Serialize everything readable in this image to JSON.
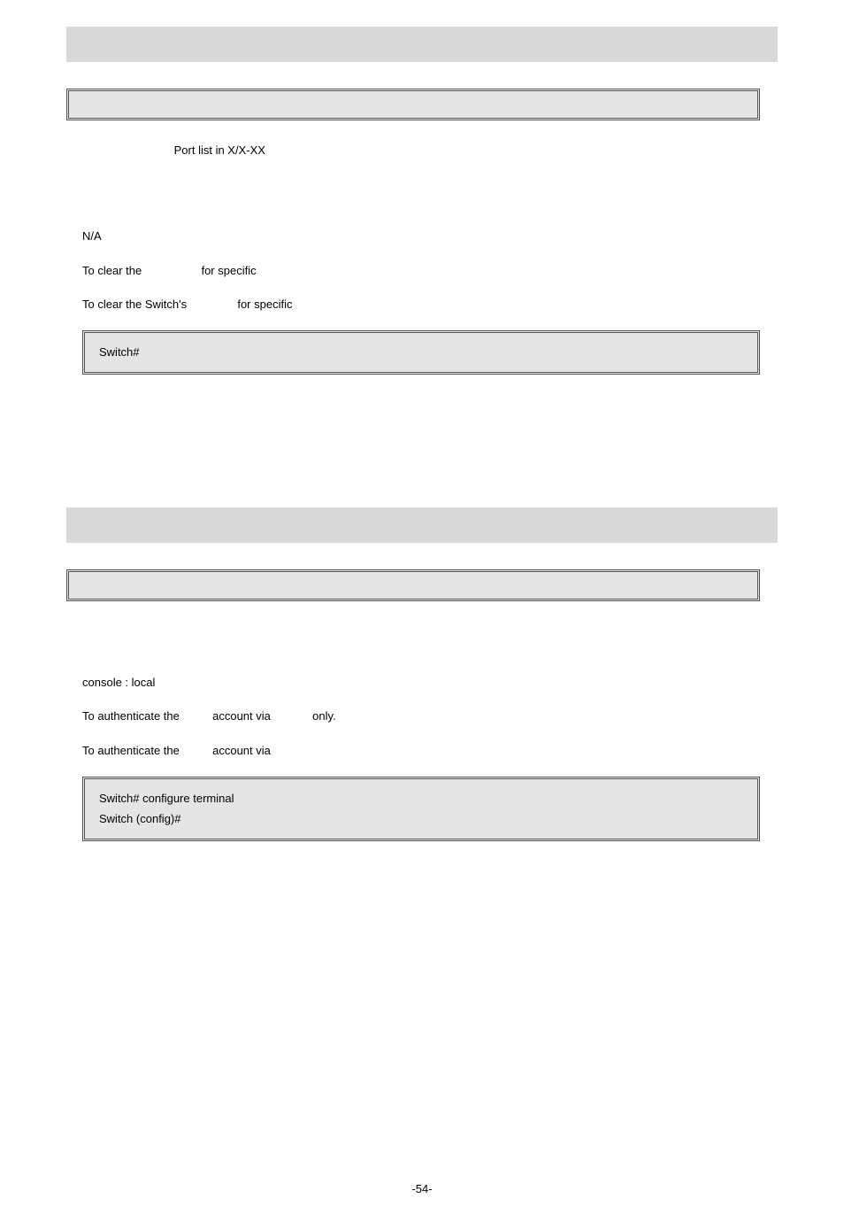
{
  "sec1": {
    "param_desc": "Port list in X/X-XX",
    "default_val": "N/A",
    "usage_line": {
      "pre": "To clear the",
      "post": "for specific"
    },
    "example_line": {
      "pre": "To clear the Switch's",
      "post": "for specific"
    },
    "example_code": "Switch#"
  },
  "sec2": {
    "default_val": "console : local",
    "usage_line": {
      "pre": "To authenticate the",
      "mid": "account via",
      "post": "only."
    },
    "example_line": {
      "pre": "To authenticate the",
      "mid": "account via"
    },
    "example_code": {
      "l1": "Switch# configure terminal",
      "l2": "Switch (config)#"
    }
  },
  "footer": "-54-"
}
